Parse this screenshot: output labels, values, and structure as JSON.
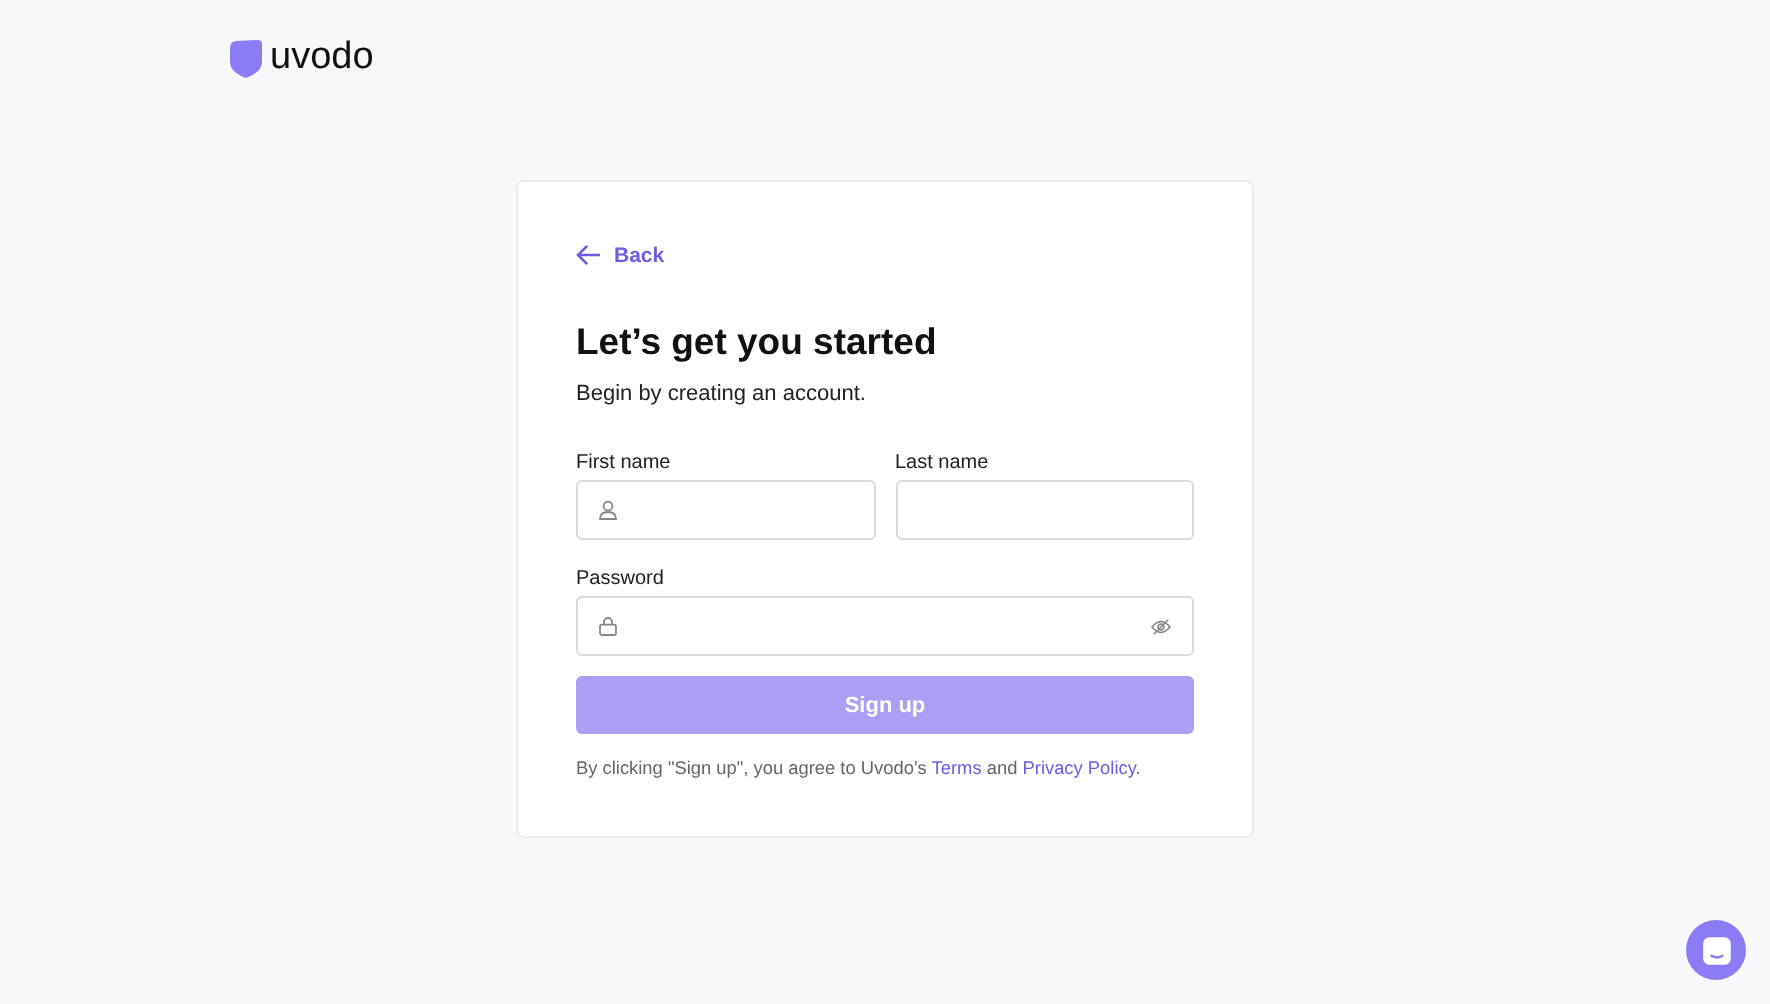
{
  "brand": {
    "name": "uvodo"
  },
  "back": {
    "label": "Back"
  },
  "heading": "Let’s get you started",
  "subheading": "Begin by creating an account.",
  "fields": [
    {
      "label": "First name",
      "kind": "name"
    },
    {
      "label": "Last name",
      "kind": "text"
    },
    {
      "label": "Password",
      "kind": "password"
    }
  ],
  "submit": {
    "label": "Sign up",
    "disabled": true
  },
  "legal": {
    "before": "By clicking \"Sign up\", you agree to Uvodo’s",
    "terms": "Terms",
    "between": "and",
    "privacy": "Privacy Policy",
    "after": "."
  }
}
